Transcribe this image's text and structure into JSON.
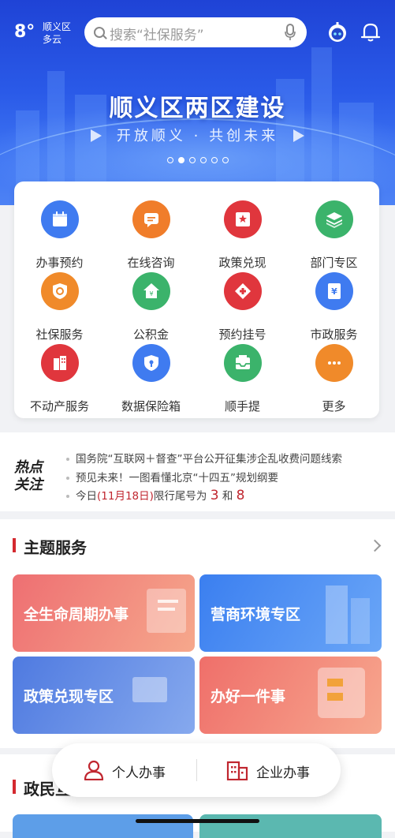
{
  "header": {
    "temperature": "8°",
    "district": "顺义区",
    "weather": "多云",
    "search_placeholder": "搜索“社保服务”"
  },
  "banner": {
    "title": "顺义区两区建设",
    "subtitle": "开放顺义 · 共创未来",
    "slide_count": 6,
    "active_slide": 1
  },
  "services": [
    {
      "label": "办事预约",
      "color": "#3f7bf0",
      "icon": "calendar-icon"
    },
    {
      "label": "在线咨询",
      "color": "#f07d2a",
      "icon": "chat-icon"
    },
    {
      "label": "政策兑现",
      "color": "#e0363d",
      "icon": "policy-icon"
    },
    {
      "label": "部门专区",
      "color": "#3bb36b",
      "icon": "layers-icon"
    },
    {
      "label": "社保服务",
      "color": "#f08a2a",
      "icon": "shield-icon"
    },
    {
      "label": "公积金",
      "color": "#3bb36b",
      "icon": "house-icon"
    },
    {
      "label": "预约挂号",
      "color": "#e0363d",
      "icon": "medical-cross-icon"
    },
    {
      "label": "市政服务",
      "color": "#3f7bf0",
      "icon": "yuan-icon"
    },
    {
      "label": "不动产服务",
      "color": "#e0363d",
      "icon": "building-icon"
    },
    {
      "label": "数据保险箱",
      "color": "#3f7bf0",
      "icon": "lock-shield-icon"
    },
    {
      "label": "顺手提",
      "color": "#3bb36b",
      "icon": "inbox-icon"
    },
    {
      "label": "更多",
      "color": "#f08a2a",
      "icon": "more-icon"
    }
  ],
  "hot_news": {
    "logo": [
      "热点",
      "关注"
    ],
    "items": [
      "国务院“互联网＋督查”平台公开征集涉企乱收费问题线索",
      "预见未来！一图看懂北京“十四五”规划纲要"
    ],
    "traffic": {
      "prefix": "今日",
      "date": "(11月18日)",
      "middle": "限行尾号为",
      "num1": "3",
      "and": "和",
      "num2": "8"
    }
  },
  "theme_section": {
    "title": "主题服务",
    "tiles": [
      {
        "label": "全生命周期办事",
        "color": "#ef7b7b"
      },
      {
        "label": "营商环境专区",
        "color": "#4a8cf0"
      },
      {
        "label": "政策兑现专区",
        "color": "#5e88e6"
      },
      {
        "label": "办好一件事",
        "color": "#f08a7a"
      }
    ]
  },
  "next_section": {
    "title": "政民互"
  },
  "bottom_nav": {
    "personal": "个人办事",
    "enterprise": "企业办事",
    "accent": "#c0262f"
  }
}
